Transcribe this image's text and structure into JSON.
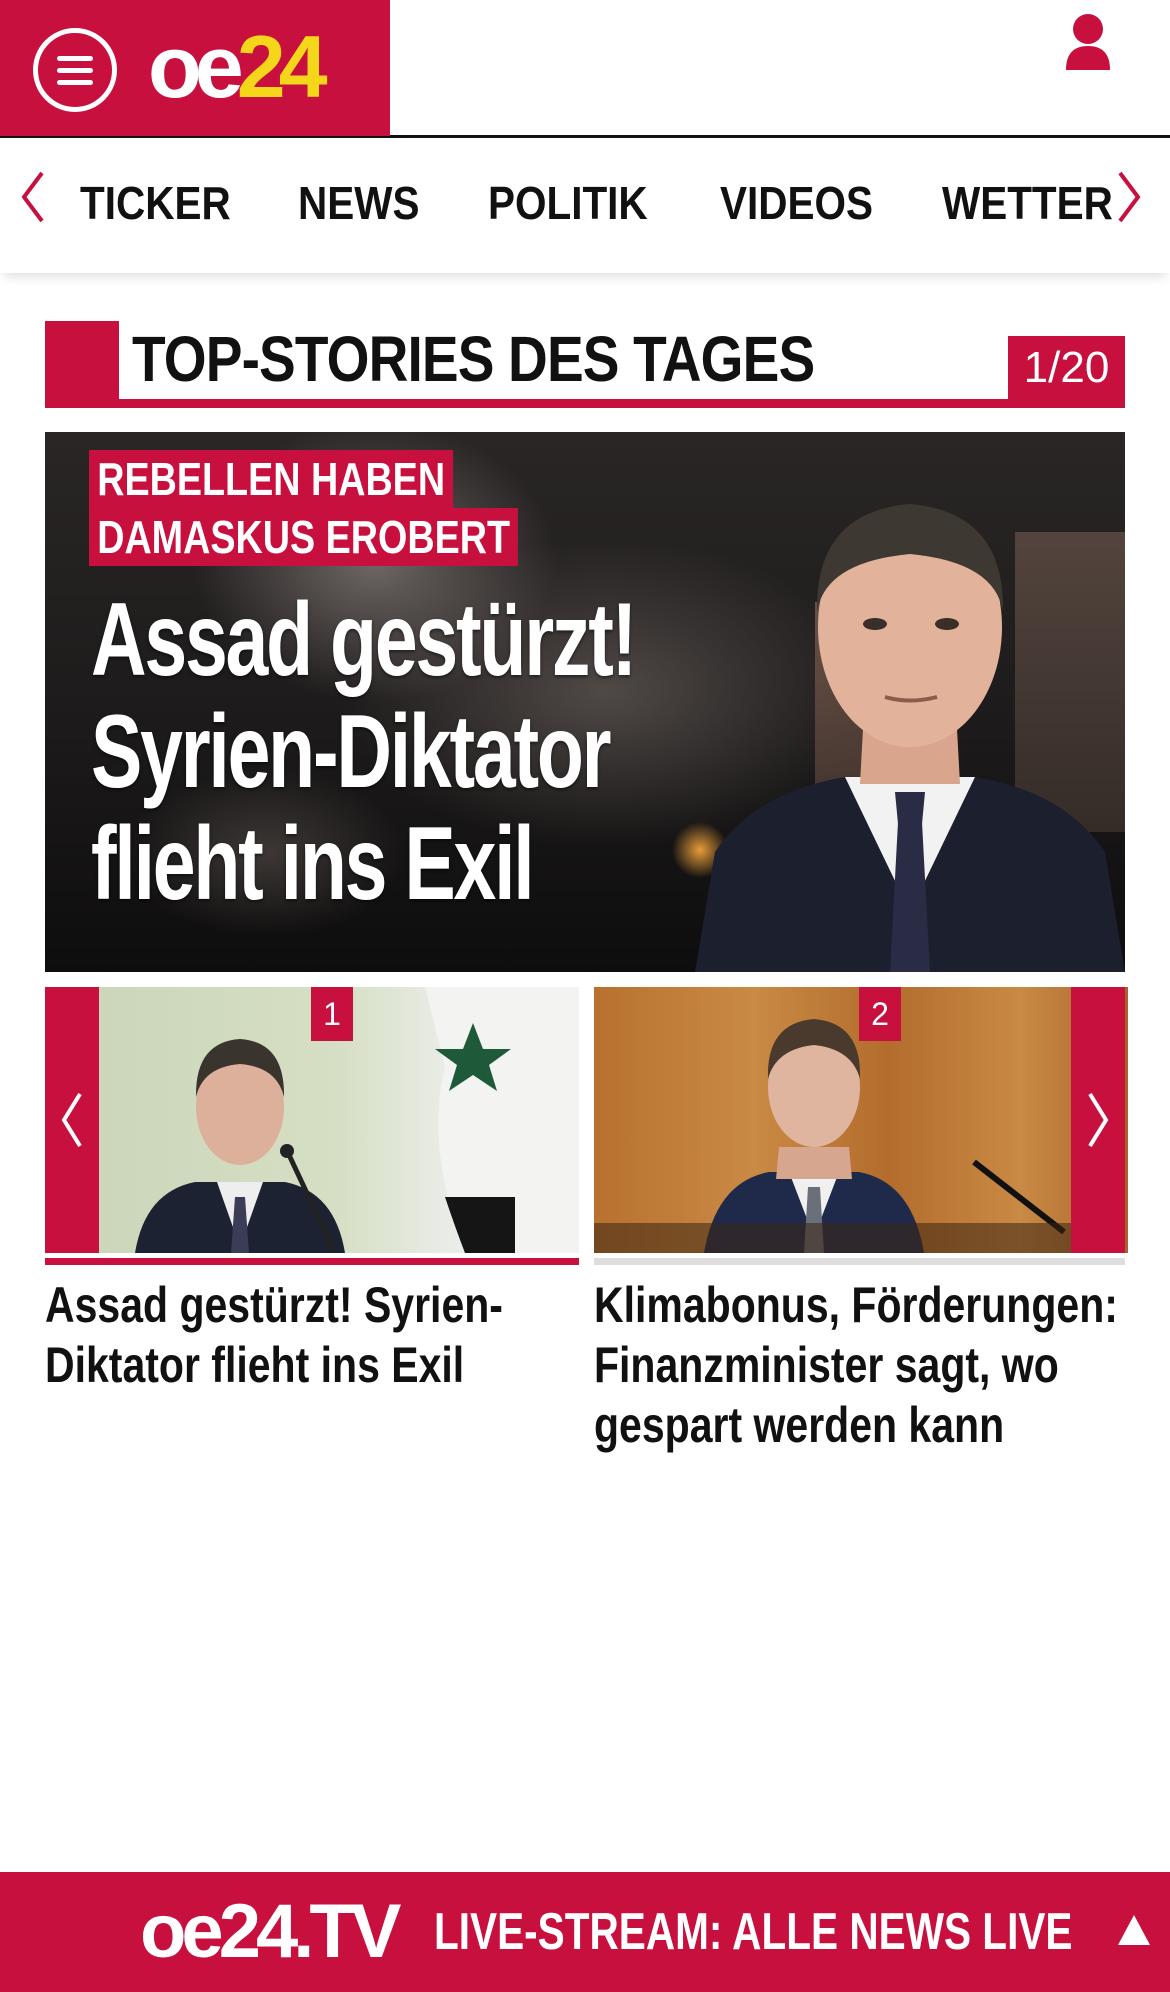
{
  "colors": {
    "brand_red": "#c8103f",
    "logo_yellow": "#f4d61b",
    "text": "#111111"
  },
  "header": {
    "menu_icon": "hamburger-menu-icon",
    "logo": {
      "part1": "oe",
      "part2": "24"
    },
    "user_icon": "user-icon"
  },
  "nav": {
    "items": [
      "TICKER",
      "NEWS",
      "POLITIK",
      "VIDEOS",
      "WETTER"
    ],
    "prev_icon": "chevron-left-icon",
    "next_icon": "chevron-right-icon"
  },
  "section": {
    "title": "TOP-STORIES DES TAGES",
    "counter": "1/20"
  },
  "hero": {
    "kicker": [
      "REBELLEN HABEN",
      "DAMASKUS EROBERT"
    ],
    "headline": [
      "Assad gestürzt!",
      "Syrien-Diktator",
      "flieht ins Exil"
    ]
  },
  "carousel": {
    "items": [
      {
        "badge": "1",
        "title": "Assad gestürzt! Syrien-Diktator flieht ins Exil",
        "active": true
      },
      {
        "badge": "2",
        "title": "Klimabonus, Förderungen: Finanzminister sagt, wo gespart werden kann",
        "active": false
      }
    ],
    "prev_icon": "chevron-left-icon",
    "next_icon": "chevron-right-icon"
  },
  "livebar": {
    "logo": "oe24.TV",
    "text": "LIVE-STREAM:  ALLE NEWS LIVE",
    "expand_icon": "triangle-up-icon"
  }
}
